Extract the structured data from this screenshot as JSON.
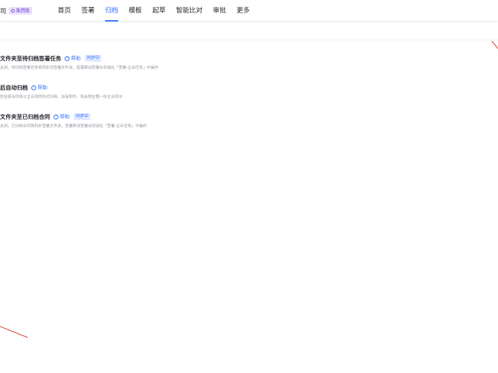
{
  "header": {
    "company_text": "司",
    "company_badge": "集团版",
    "nav": [
      {
        "label": "首页",
        "active": false
      },
      {
        "label": "签署",
        "active": false
      },
      {
        "label": "归档",
        "active": true
      },
      {
        "label": "模板",
        "active": false
      },
      {
        "label": "起草",
        "active": false
      },
      {
        "label": "智能比对",
        "active": false
      },
      {
        "label": "审批",
        "active": false
      },
      {
        "label": "更多",
        "active": false
      }
    ]
  },
  "settings": [
    {
      "title": "文件夹至待归档签署任务",
      "help": "帮助",
      "tag": "同步中",
      "desc": "关闭，待归档签署任务将同步到签署文件夹，若需移动签署合同请在「签署-企业任务」中操作"
    },
    {
      "title": "后自动归档",
      "help": "帮助",
      "tag": "",
      "desc": "的全部合同将以主合同的形式归档，如有附件，将会附在第一份主合同中"
    },
    {
      "title": "文件夹至已归档合同",
      "help": "帮助",
      "tag": "同步中",
      "desc": "关闭，已归档合同将同步签署文件夹，签署移动签署合同请在「签署-企业任务」中操作"
    }
  ],
  "colors": {
    "accent": "#3370ff",
    "badge_bg": "#eadffb",
    "badge_text": "#7b4ad6",
    "tag_bg": "#e1eaff",
    "annotation": "#e0362b"
  },
  "icons": {
    "help": "question-circle-icon",
    "badge": "circle-icon"
  }
}
